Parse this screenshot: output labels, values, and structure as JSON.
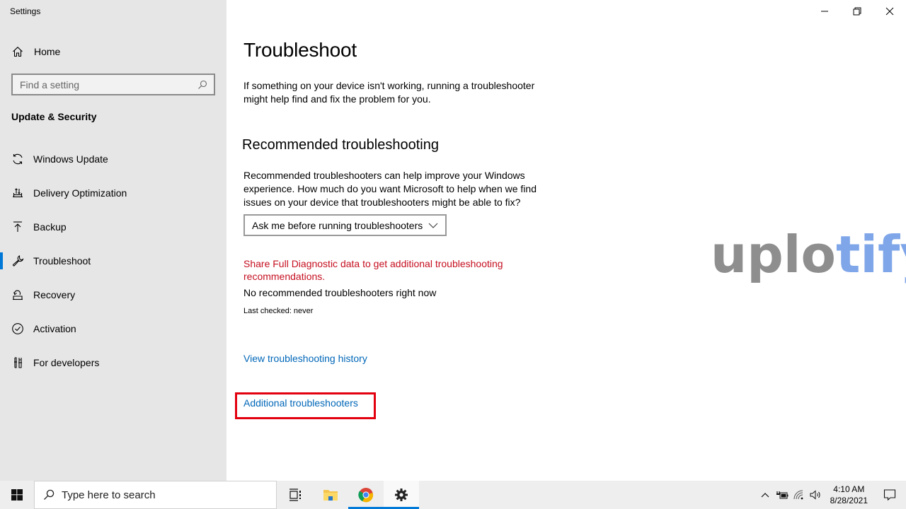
{
  "window": {
    "app_title": "Settings",
    "controls": {
      "minimize": "minimize-icon",
      "maximize": "restore-icon",
      "close": "close-icon"
    }
  },
  "sidebar": {
    "home_label": "Home",
    "search_placeholder": "Find a setting",
    "section_title": "Update & Security",
    "items": [
      {
        "label": "Windows Update",
        "icon": "sync-icon",
        "active": false
      },
      {
        "label": "Delivery Optimization",
        "icon": "delivery-optimization-icon",
        "active": false
      },
      {
        "label": "Backup",
        "icon": "backup-icon",
        "active": false
      },
      {
        "label": "Troubleshoot",
        "icon": "wrench-icon",
        "active": true
      },
      {
        "label": "Recovery",
        "icon": "recovery-icon",
        "active": false
      },
      {
        "label": "Activation",
        "icon": "activation-check-icon",
        "active": false
      },
      {
        "label": "For developers",
        "icon": "developer-tools-icon",
        "active": false
      }
    ]
  },
  "main": {
    "title": "Troubleshoot",
    "intro": "If something on your device isn't working, running a troubleshooter might help find and fix the problem for you.",
    "recommended": {
      "heading": "Recommended troubleshooting",
      "description": "Recommended troubleshooters can help improve your Windows experience. How much do you want Microsoft to help when we find issues on your device that troubleshooters might be able to fix?",
      "dropdown_value": "Ask me before running troubleshooters",
      "warning_link": "Share Full Diagnostic data to get additional troubleshooting recommendations.",
      "status": "No recommended troubleshooters right now",
      "last_checked": "Last checked: never"
    },
    "history_link": "View troubleshooting history",
    "additional_link": "Additional troubleshooters"
  },
  "watermark": {
    "part1": "uplo",
    "part2": "tify"
  },
  "taskbar": {
    "search_placeholder": "Type here to search",
    "pinned": [
      {
        "name": "task-view",
        "icon": "task-view-icon"
      },
      {
        "name": "file-explorer",
        "icon": "folder-icon"
      },
      {
        "name": "chrome",
        "icon": "chrome-icon"
      },
      {
        "name": "settings",
        "icon": "gear-icon",
        "active": true
      }
    ],
    "time": "4:10 AM",
    "date": "8/28/2021"
  },
  "colors": {
    "accent": "#0078d7",
    "link": "#0067b8",
    "warning": "#c50f1f",
    "highlight_box": "#e3000f"
  }
}
